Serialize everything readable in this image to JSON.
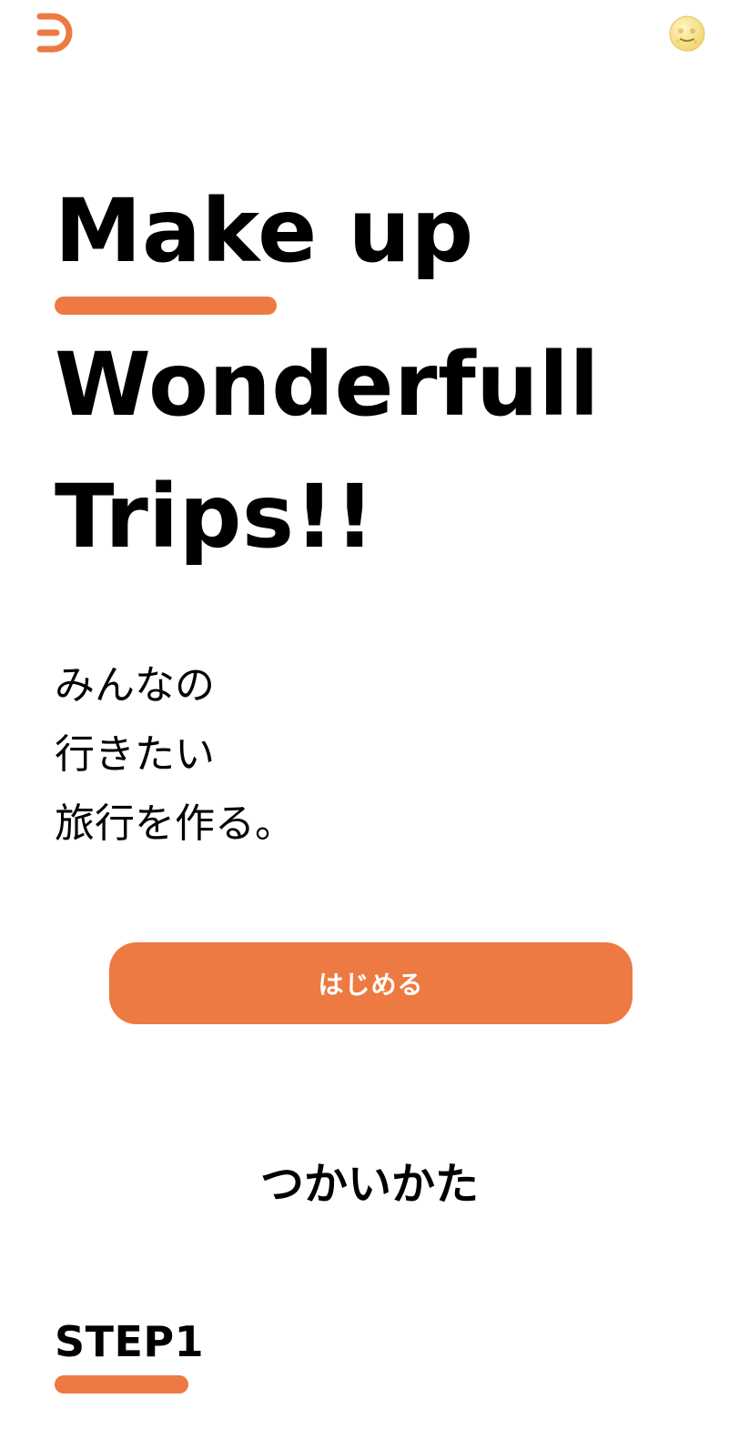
{
  "theme": {
    "accent": "#ED7A42",
    "text": "#000000",
    "background": "#ffffff"
  },
  "header": {
    "logo_icon": "app-logo-icon",
    "theme_toggle_icon": "moon-face-icon"
  },
  "hero": {
    "lines": [
      "Make up",
      "Wonderfull",
      "Trips!!"
    ]
  },
  "tagline": {
    "lines": [
      "みんなの",
      "行きたい",
      "旅行を作る。"
    ]
  },
  "cta": {
    "label": "はじめる"
  },
  "how_to": {
    "title": "つかいかた",
    "steps": [
      {
        "label": "STEP1"
      }
    ]
  }
}
